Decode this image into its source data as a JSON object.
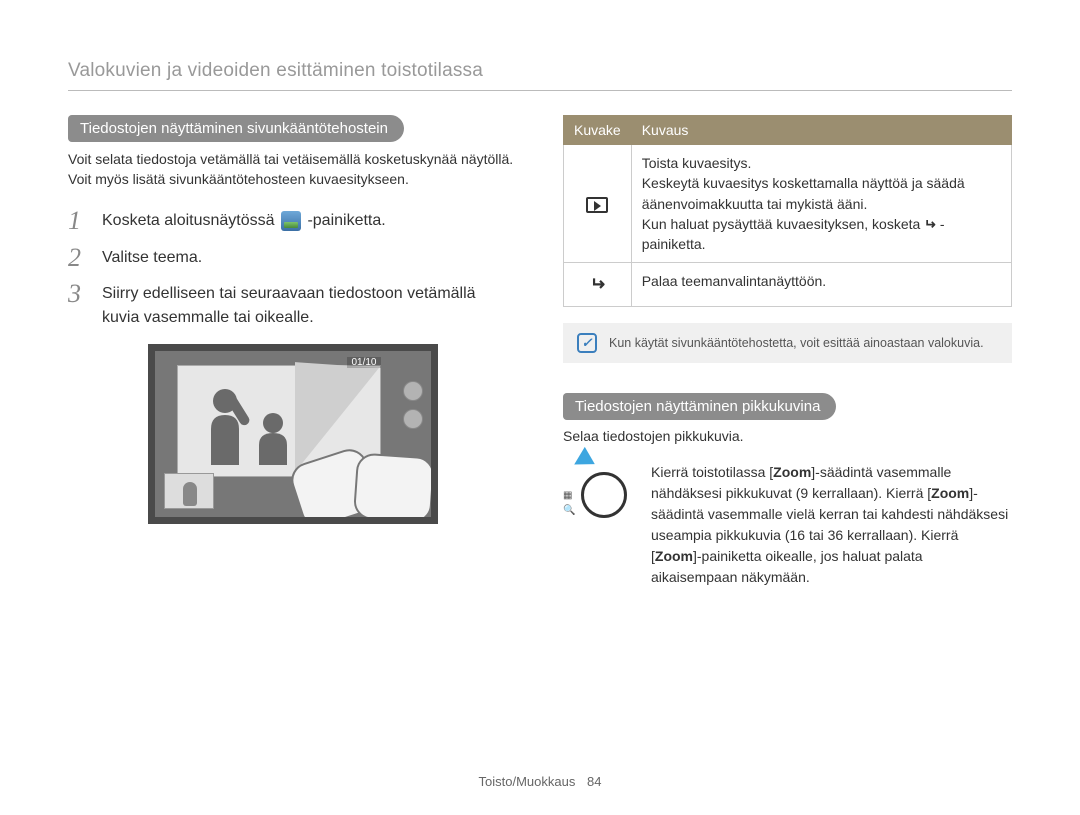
{
  "header": "Valokuvien ja videoiden esittäminen toistotilassa",
  "left": {
    "pill": "Tiedostojen näyttäminen sivunkääntötehostein",
    "intro": "Voit selata tiedostoja vetämällä tai vetäisemällä kosketuskynää näytöllä. Voit myös lisätä sivunkääntötehosteen kuvaesitykseen.",
    "steps": [
      {
        "num": "1",
        "pre": "Kosketa aloitusnäytössä ",
        "post": "-painiketta."
      },
      {
        "num": "2",
        "text": "Valitse teema."
      },
      {
        "num": "3",
        "text": "Siirry edelliseen tai seuraavaan tiedostoon vetämällä kuvia vasemmalle tai oikealle."
      }
    ],
    "screen": {
      "counter": "01/10"
    }
  },
  "right": {
    "table": {
      "head": {
        "icon": "Kuvake",
        "desc": "Kuvaus"
      },
      "row1_line1": "Toista kuvaesitys.",
      "row1_line2": "Keskeytä kuvaesitys koskettamalla näyttöä ja säädä äänenvoimakkuutta tai mykistä ääni.",
      "row1_line3_pre": "Kun haluat pysäyttää kuvaesityksen, kosketa ",
      "row1_line3_post": " -painiketta.",
      "row2": "Palaa teemanvalintanäyttöön."
    },
    "note": "Kun käytät sivunkääntötehostetta, voit esittää ainoastaan valokuvia.",
    "pill2": "Tiedostojen näyttäminen pikkukuvina",
    "sub_intro": "Selaa tiedostojen pikkukuvia.",
    "zoom": {
      "t1": "Kierrä toistotilassa [",
      "b1": "Zoom",
      "t2": "]-säädintä vasemmalle nähdäksesi pikkukuvat (9 kerrallaan). Kierrä [",
      "b2": "Zoom",
      "t3": "]-säädintä vasemmalle vielä kerran tai kahdesti nähdäksesi useampia pikkukuvia (16 tai 36 kerrallaan). Kierrä [",
      "b3": "Zoom",
      "t4": "]-painiketta oikealle, jos haluat palata aikaisempaan näkymään."
    }
  },
  "footer": {
    "section": "Toisto/Muokkaus",
    "page": "84"
  }
}
